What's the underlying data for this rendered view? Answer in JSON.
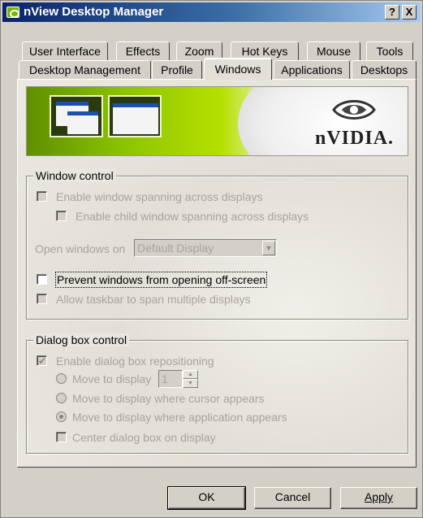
{
  "window": {
    "title": "nView Desktop Manager",
    "help_btn": "?",
    "close_btn": "X"
  },
  "tabs_row1": [
    "User Interface",
    "Effects",
    "Zoom",
    "Hot Keys",
    "Mouse",
    "Tools"
  ],
  "tabs_row2": [
    "Desktop Management",
    "Profile",
    "Windows",
    "Applications",
    "Desktops"
  ],
  "active_tab": "Windows",
  "banner": {
    "logo_text": "nVIDIA.",
    "brand_color": "#76b900"
  },
  "window_control": {
    "legend": "Window control",
    "enable_spanning": {
      "label": "Enable window spanning across displays",
      "checked": false,
      "enabled": false
    },
    "enable_child_spanning": {
      "label": "Enable child window spanning across displays",
      "checked": false,
      "enabled": false
    },
    "open_windows_on": {
      "label": "Open windows on",
      "value": "Default Display",
      "enabled": false
    },
    "prevent_offscreen": {
      "label": "Prevent windows from opening off-screen",
      "checked": false,
      "enabled": true
    },
    "allow_taskbar_span": {
      "label": "Allow taskbar to span multiple displays",
      "checked": false,
      "enabled": false
    }
  },
  "dialog_control": {
    "legend": "Dialog box control",
    "enable_repositioning": {
      "label": "Enable dialog box repositioning",
      "checked": true,
      "enabled": false
    },
    "move_to_display": {
      "label": "Move to display",
      "value": "1",
      "selected": false
    },
    "move_to_cursor": {
      "label": "Move to display where cursor appears",
      "selected": false
    },
    "move_to_application": {
      "label": "Move to display where application appears",
      "selected": true
    },
    "center_dialog": {
      "label": "Center dialog box on display",
      "checked": false,
      "enabled": false
    }
  },
  "buttons": {
    "ok": "OK",
    "cancel": "Cancel",
    "apply": "Apply"
  }
}
